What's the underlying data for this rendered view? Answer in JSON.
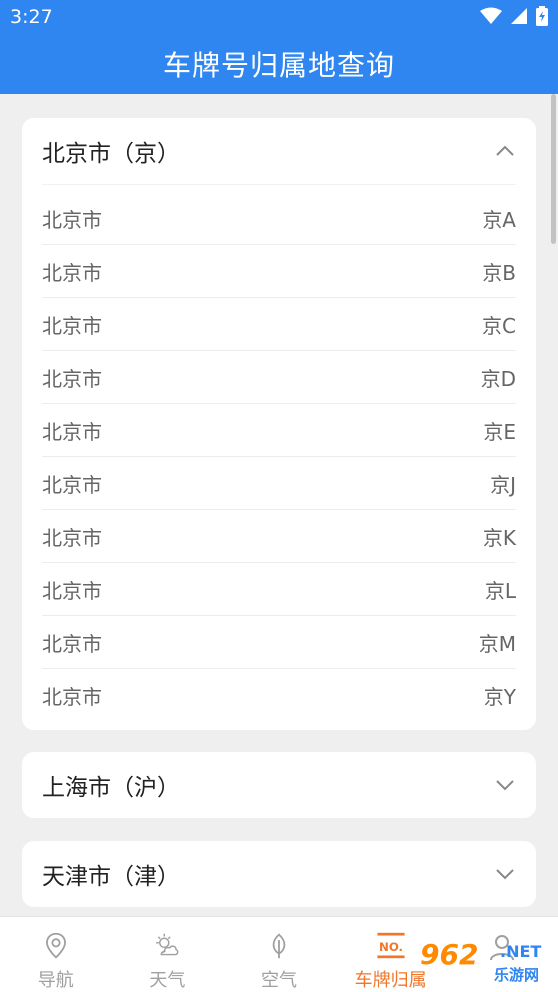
{
  "status_bar": {
    "time": "3:27"
  },
  "app_bar": {
    "title": "车牌号归属地查询"
  },
  "provinces": [
    {
      "title": "北京市（京）",
      "expanded": true,
      "rows": [
        {
          "city": "北京市",
          "code": "京A"
        },
        {
          "city": "北京市",
          "code": "京B"
        },
        {
          "city": "北京市",
          "code": "京C"
        },
        {
          "city": "北京市",
          "code": "京D"
        },
        {
          "city": "北京市",
          "code": "京E"
        },
        {
          "city": "北京市",
          "code": "京J"
        },
        {
          "city": "北京市",
          "code": "京K"
        },
        {
          "city": "北京市",
          "code": "京L"
        },
        {
          "city": "北京市",
          "code": "京M"
        },
        {
          "city": "北京市",
          "code": "京Y"
        }
      ]
    },
    {
      "title": "上海市（沪）",
      "expanded": false
    },
    {
      "title": "天津市（津）",
      "expanded": false
    }
  ],
  "bottom_nav": {
    "items": [
      {
        "label": "导航",
        "icon": "location-pin-icon"
      },
      {
        "label": "天气",
        "icon": "weather-icon"
      },
      {
        "label": "空气",
        "icon": "leaf-icon"
      },
      {
        "label": "车牌归属",
        "icon": "plate-no-icon",
        "active": true
      },
      {
        "label": "",
        "icon": "profile-icon"
      }
    ]
  },
  "watermark": {
    "number": "962",
    "domain": ".NET",
    "text": "乐游网"
  },
  "colors": {
    "primary": "#2f86f1",
    "active": "#f0762a",
    "inactive": "#a0a0a0",
    "background": "#efefef"
  }
}
